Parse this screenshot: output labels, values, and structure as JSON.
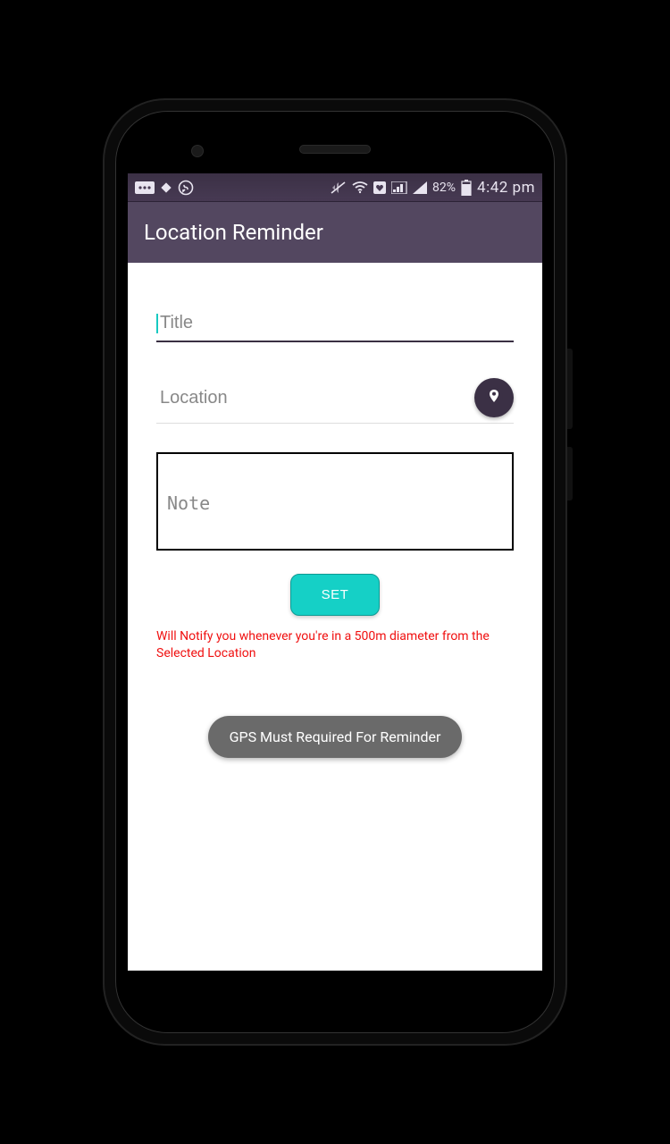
{
  "status_bar": {
    "battery_pct": "82%",
    "time": "4:42 pm"
  },
  "header": {
    "title": "Location Reminder"
  },
  "form": {
    "title_placeholder": "Title",
    "title_value": "",
    "location_placeholder": "Location",
    "location_value": "",
    "note_placeholder": "Note",
    "note_value": "",
    "set_button": "SET",
    "notice": "Will Notify you whenever you're in a 500m diameter from the Selected Location",
    "gps_required": "GPS Must Required For Reminder"
  },
  "icons": {
    "location_pin": "location-pin-icon"
  }
}
